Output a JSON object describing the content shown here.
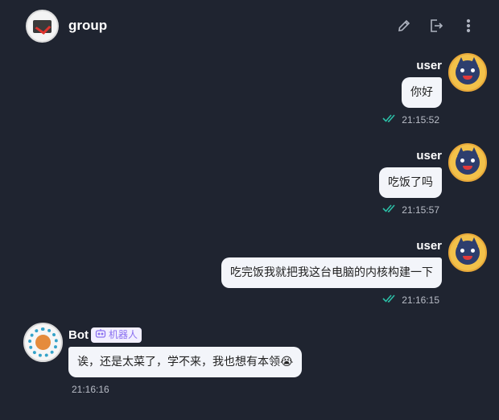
{
  "header": {
    "title": "group",
    "icons": [
      "edit-icon",
      "exit-icon",
      "more-icon"
    ]
  },
  "messages": [
    {
      "sender": "user",
      "text": "你好",
      "time": "21:15:52",
      "status": "read"
    },
    {
      "sender": "user",
      "text": "吃饭了吗",
      "time": "21:15:57",
      "status": "read"
    },
    {
      "sender": "user",
      "text": "吃完饭我就把我这台电脑的内核构建一下",
      "time": "21:16:15",
      "status": "read"
    }
  ],
  "bot_message": {
    "sender": "Bot",
    "badge": "机器人",
    "text": "诶，还是太菜了，学不来，我也想有本领😭",
    "time": "21:16:16"
  },
  "colors": {
    "background": "#1f2430",
    "bubble": "#f3f5fa",
    "read_check": "#2bbfa6",
    "badge_text": "#8a6ff0"
  }
}
